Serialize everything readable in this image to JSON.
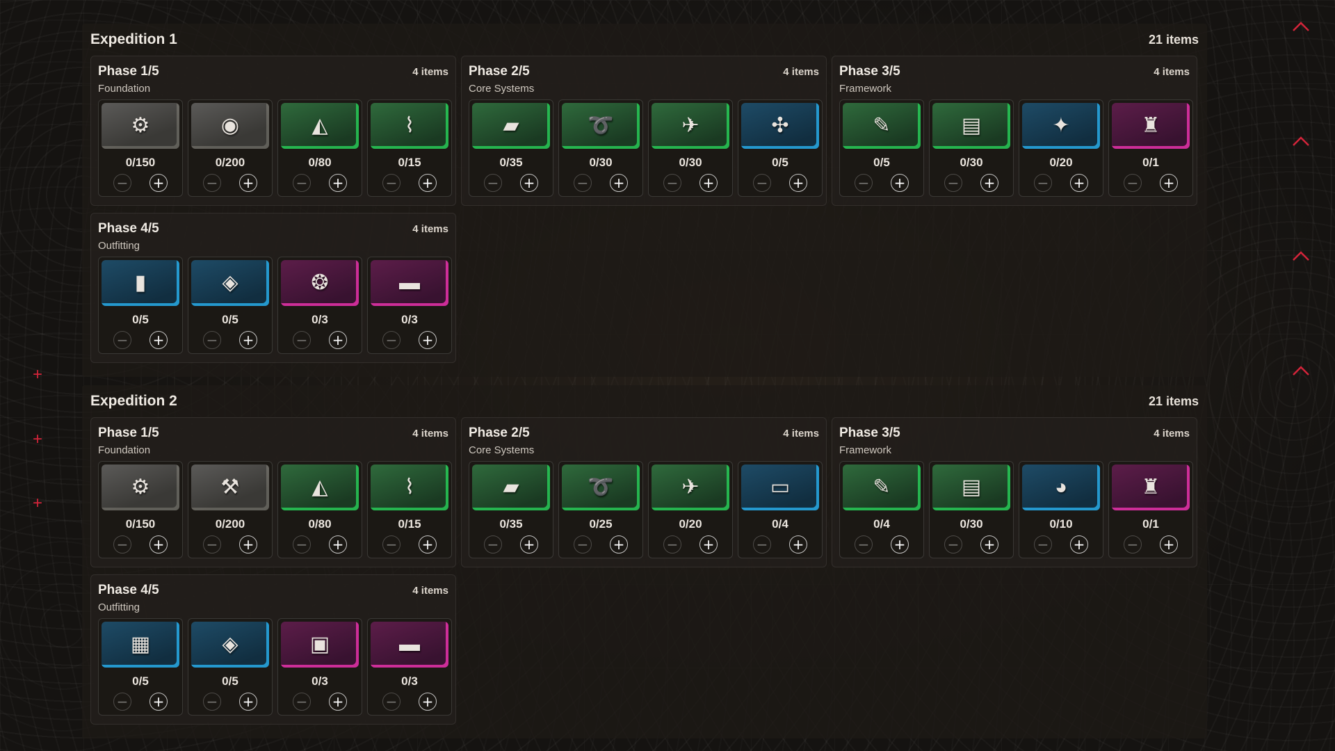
{
  "colors": {
    "accent": "#d4243a",
    "rarity_common": "#9a968e",
    "rarity_uncommon": "#28d25a",
    "rarity_rare": "#28aae6",
    "rarity_epic": "#e632aa"
  },
  "expeditions": [
    {
      "title": "Expedition 1",
      "count": "21 items",
      "phases": [
        {
          "title": "Phase 1/5",
          "count": "4 items",
          "subtitle": "Foundation",
          "items": [
            {
              "qty": "0/150",
              "rarity": "grey",
              "icon": "metal-parts-icon",
              "glyph": "⚙"
            },
            {
              "qty": "0/200",
              "rarity": "grey",
              "icon": "rubber-parts-icon",
              "glyph": "◉"
            },
            {
              "qty": "0/80",
              "rarity": "green",
              "icon": "arc-alloy-icon",
              "glyph": "◭"
            },
            {
              "qty": "0/15",
              "rarity": "green",
              "icon": "spring-icon",
              "glyph": "⌇"
            }
          ]
        },
        {
          "title": "Phase 2/5",
          "count": "4 items",
          "subtitle": "Core Systems",
          "items": [
            {
              "qty": "0/35",
              "rarity": "green",
              "icon": "fabric-icon",
              "glyph": "▰"
            },
            {
              "qty": "0/30",
              "rarity": "green",
              "icon": "wire-icon",
              "glyph": "➰"
            },
            {
              "qty": "0/30",
              "rarity": "green",
              "icon": "component-icon",
              "glyph": "✈"
            },
            {
              "qty": "0/5",
              "rarity": "blue",
              "icon": "fan-icon",
              "glyph": "✣"
            }
          ]
        },
        {
          "title": "Phase 3/5",
          "count": "4 items",
          "subtitle": "Framework",
          "items": [
            {
              "qty": "0/5",
              "rarity": "green",
              "icon": "bulb-icon",
              "glyph": "✎"
            },
            {
              "qty": "0/30",
              "rarity": "green",
              "icon": "battery-icon",
              "glyph": "▤"
            },
            {
              "qty": "0/20",
              "rarity": "blue",
              "icon": "circuit-icon",
              "glyph": "✦"
            },
            {
              "qty": "0/1",
              "rarity": "pink",
              "icon": "engine-icon",
              "glyph": "♜"
            }
          ]
        },
        {
          "title": "Phase 4/5",
          "count": "4 items",
          "subtitle": "Outfitting",
          "items": [
            {
              "qty": "0/5",
              "rarity": "blue",
              "icon": "canister-icon",
              "glyph": "▮"
            },
            {
              "qty": "0/5",
              "rarity": "blue",
              "icon": "grille-icon",
              "glyph": "◈"
            },
            {
              "qty": "0/3",
              "rarity": "pink",
              "icon": "reactor-core-icon",
              "glyph": "❂"
            },
            {
              "qty": "0/3",
              "rarity": "pink",
              "icon": "barrel-icon",
              "glyph": "▬"
            }
          ]
        }
      ]
    },
    {
      "title": "Expedition 2",
      "count": "21 items",
      "phases": [
        {
          "title": "Phase 1/5",
          "count": "4 items",
          "subtitle": "Foundation",
          "items": [
            {
              "qty": "0/150",
              "rarity": "grey",
              "icon": "metal-parts-icon",
              "glyph": "⚙"
            },
            {
              "qty": "0/200",
              "rarity": "grey",
              "icon": "mechanical-parts-icon",
              "glyph": "⚒"
            },
            {
              "qty": "0/80",
              "rarity": "green",
              "icon": "arc-alloy-icon",
              "glyph": "◭"
            },
            {
              "qty": "0/15",
              "rarity": "green",
              "icon": "spring-icon",
              "glyph": "⌇"
            }
          ]
        },
        {
          "title": "Phase 2/5",
          "count": "4 items",
          "subtitle": "Core Systems",
          "items": [
            {
              "qty": "0/35",
              "rarity": "green",
              "icon": "fabric-icon",
              "glyph": "▰"
            },
            {
              "qty": "0/25",
              "rarity": "green",
              "icon": "wire-icon",
              "glyph": "➰"
            },
            {
              "qty": "0/20",
              "rarity": "green",
              "icon": "component-icon",
              "glyph": "✈"
            },
            {
              "qty": "0/4",
              "rarity": "blue",
              "icon": "rod-icon",
              "glyph": "▭"
            }
          ]
        },
        {
          "title": "Phase 3/5",
          "count": "4 items",
          "subtitle": "Framework",
          "items": [
            {
              "qty": "0/4",
              "rarity": "green",
              "icon": "bulb-icon",
              "glyph": "✎"
            },
            {
              "qty": "0/30",
              "rarity": "green",
              "icon": "battery-icon",
              "glyph": "▤"
            },
            {
              "qty": "0/10",
              "rarity": "blue",
              "icon": "motor-icon",
              "glyph": "◕"
            },
            {
              "qty": "0/1",
              "rarity": "pink",
              "icon": "engine-icon",
              "glyph": "♜"
            }
          ]
        },
        {
          "title": "Phase 4/5",
          "count": "4 items",
          "subtitle": "Outfitting",
          "items": [
            {
              "qty": "0/5",
              "rarity": "blue",
              "icon": "plate-icon",
              "glyph": "▦"
            },
            {
              "qty": "0/5",
              "rarity": "blue",
              "icon": "grille-icon",
              "glyph": "◈"
            },
            {
              "qty": "0/3",
              "rarity": "pink",
              "icon": "device-icon",
              "glyph": "▣"
            },
            {
              "qty": "0/3",
              "rarity": "pink",
              "icon": "barrel-icon",
              "glyph": "▬"
            }
          ]
        }
      ]
    }
  ],
  "controls": {
    "minus": "−",
    "plus": "+"
  },
  "side_markers": {
    "cross": "+"
  }
}
